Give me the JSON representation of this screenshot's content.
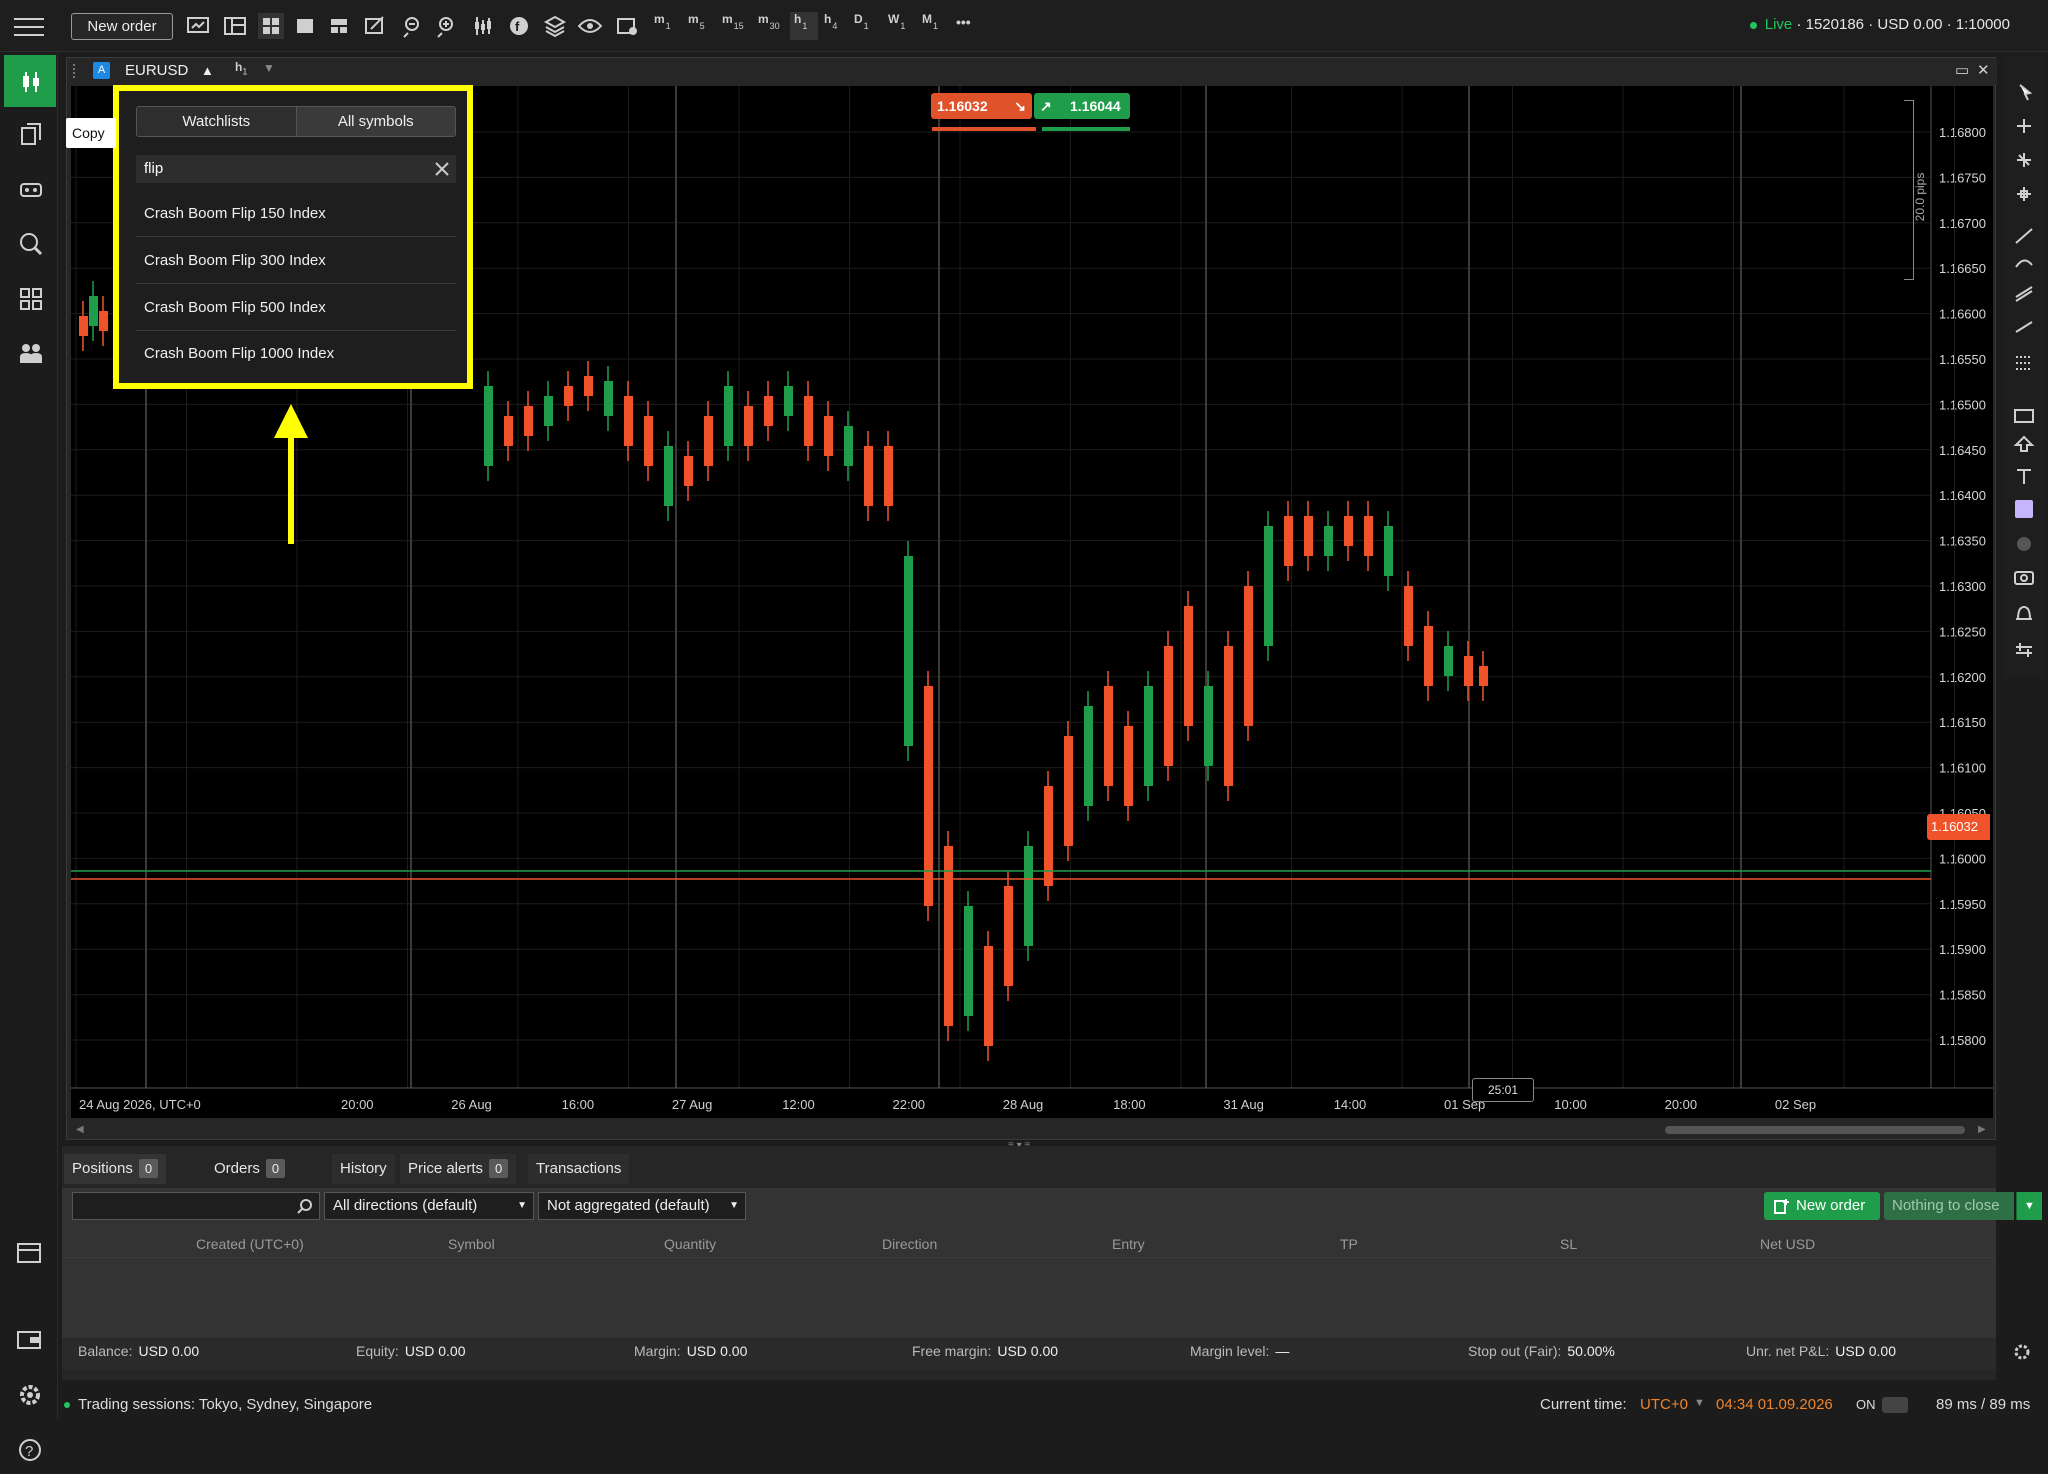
{
  "toolbar": {
    "new_order_label": "New order",
    "timeframes": [
      "m1",
      "m5",
      "m15",
      "m30",
      "h1",
      "h4",
      "D1",
      "W1",
      "M1"
    ],
    "timeframe_labels": [
      {
        "main": "m",
        "sub": "1"
      },
      {
        "main": "m",
        "sub": "5"
      },
      {
        "main": "m",
        "sub": "15"
      },
      {
        "main": "m",
        "sub": "30"
      },
      {
        "main": "h",
        "sub": "1"
      },
      {
        "main": "h",
        "sub": "4"
      },
      {
        "main": "D",
        "sub": "1"
      },
      {
        "main": "W",
        "sub": "1"
      },
      {
        "main": "M",
        "sub": "1"
      }
    ],
    "selected_timeframe": "h1",
    "more_label": "•••",
    "account": {
      "status": "Live",
      "number": "1520186",
      "balance": "USD 0.00",
      "leverage": "1:10000",
      "status_color": "#22c55e"
    }
  },
  "left_sidebar": {
    "items": [
      "trade-icon",
      "copy-icon",
      "automate-icon",
      "analyze-icon",
      "dashboard-icon",
      "community-icon"
    ],
    "bottom_items": [
      "cashier-icon",
      "wallet-icon",
      "settings-icon",
      "help-icon"
    ],
    "tooltip": "Copy"
  },
  "chart_window": {
    "symbol": "EURUSD",
    "symbol_tag": "A",
    "direction_arrow": "▲",
    "timeframe": {
      "main": "h",
      "sub": "1"
    },
    "sell_price": "1.16032",
    "buy_price": "1.16044",
    "current_price_label": "1.16032",
    "pips_label": "20.0 pips",
    "countdown": "25:01",
    "price_axis": [
      "1.16800",
      "1.16750",
      "1.16700",
      "1.16650",
      "1.16600",
      "1.16550",
      "1.16500",
      "1.16450",
      "1.16400",
      "1.16350",
      "1.16300",
      "1.16250",
      "1.16200",
      "1.16150",
      "1.16100",
      "1.16050",
      "1.16000",
      "1.15950",
      "1.15900",
      "1.15850",
      "1.15800"
    ],
    "time_axis": [
      "24 Aug 2026, UTC+0",
      "20:00",
      "26 Aug",
      "16:00",
      "27 Aug",
      "12:00",
      "22:00",
      "28 Aug",
      "18:00",
      "31 Aug",
      "14:00",
      "01 Sep",
      "10:00",
      "20:00",
      "02 Sep"
    ],
    "colors": {
      "up": "#1f9d4a",
      "down": "#f0522a",
      "bg": "#000000"
    }
  },
  "symbol_popup": {
    "tabs": [
      "Watchlists",
      "All symbols"
    ],
    "selected_tab": "All symbols",
    "search_value": "flip",
    "results": [
      "Crash Boom Flip 150 Index",
      "Crash Boom Flip 300 Index",
      "Crash Boom Flip 500 Index",
      "Crash Boom Flip 1000 Index"
    ],
    "highlight_color": "#ffff00"
  },
  "bottom_panel": {
    "tabs": [
      {
        "label": "Positions",
        "count": "0"
      },
      {
        "label": "Orders",
        "count": "0"
      },
      {
        "label": "History"
      },
      {
        "label": "Price alerts",
        "count": "0"
      },
      {
        "label": "Transactions"
      }
    ],
    "filter_direction": "All directions (default)",
    "filter_aggregation": "Not aggregated (default)",
    "new_order_label": "New order",
    "close_label": "Nothing to close",
    "columns": [
      "Created (UTC+0)",
      "Symbol",
      "Quantity",
      "Direction",
      "Entry",
      "TP",
      "SL",
      "Net USD"
    ],
    "footer": [
      {
        "label": "Balance:",
        "value": "USD 0.00"
      },
      {
        "label": "Equity:",
        "value": "USD 0.00"
      },
      {
        "label": "Margin:",
        "value": "USD 0.00"
      },
      {
        "label": "Free margin:",
        "value": "USD 0.00"
      },
      {
        "label": "Margin level:",
        "value": "—"
      },
      {
        "label": "Stop out (Fair):",
        "value": "50.00%"
      },
      {
        "label": "Unr. net P&L:",
        "value": "USD 0.00"
      }
    ]
  },
  "status_bar": {
    "sessions": "Trading sessions: Tokyo, Sydney, Singapore",
    "current_time_label": "Current time:",
    "timezone": "UTC+0",
    "time": "04:34 01.09.2026",
    "toggle": "ON",
    "latency": "89 ms / 89 ms"
  }
}
